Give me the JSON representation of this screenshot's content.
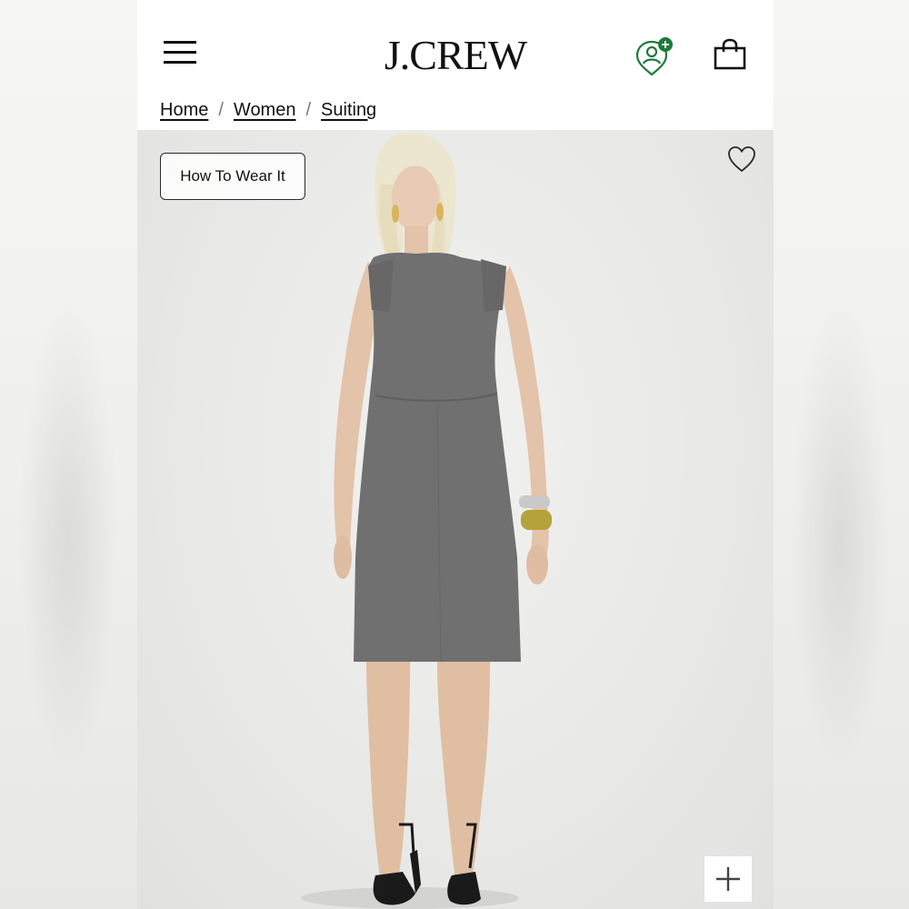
{
  "header": {
    "brand": "J.CREW",
    "icons": {
      "menu": "hamburger-menu-icon",
      "account": "account-location-plus-icon",
      "bag": "shopping-bag-icon"
    }
  },
  "breadcrumb": [
    {
      "label": "Home"
    },
    {
      "label": "Women"
    },
    {
      "label": "Suiting"
    }
  ],
  "hero": {
    "how_to_wear_label": "How To Wear It",
    "icons": {
      "favorite": "heart-icon",
      "expand": "plus-icon"
    }
  },
  "colors": {
    "accent_green": "#1e7a3c",
    "text": "#111111",
    "dress": "#6f6f6f"
  }
}
